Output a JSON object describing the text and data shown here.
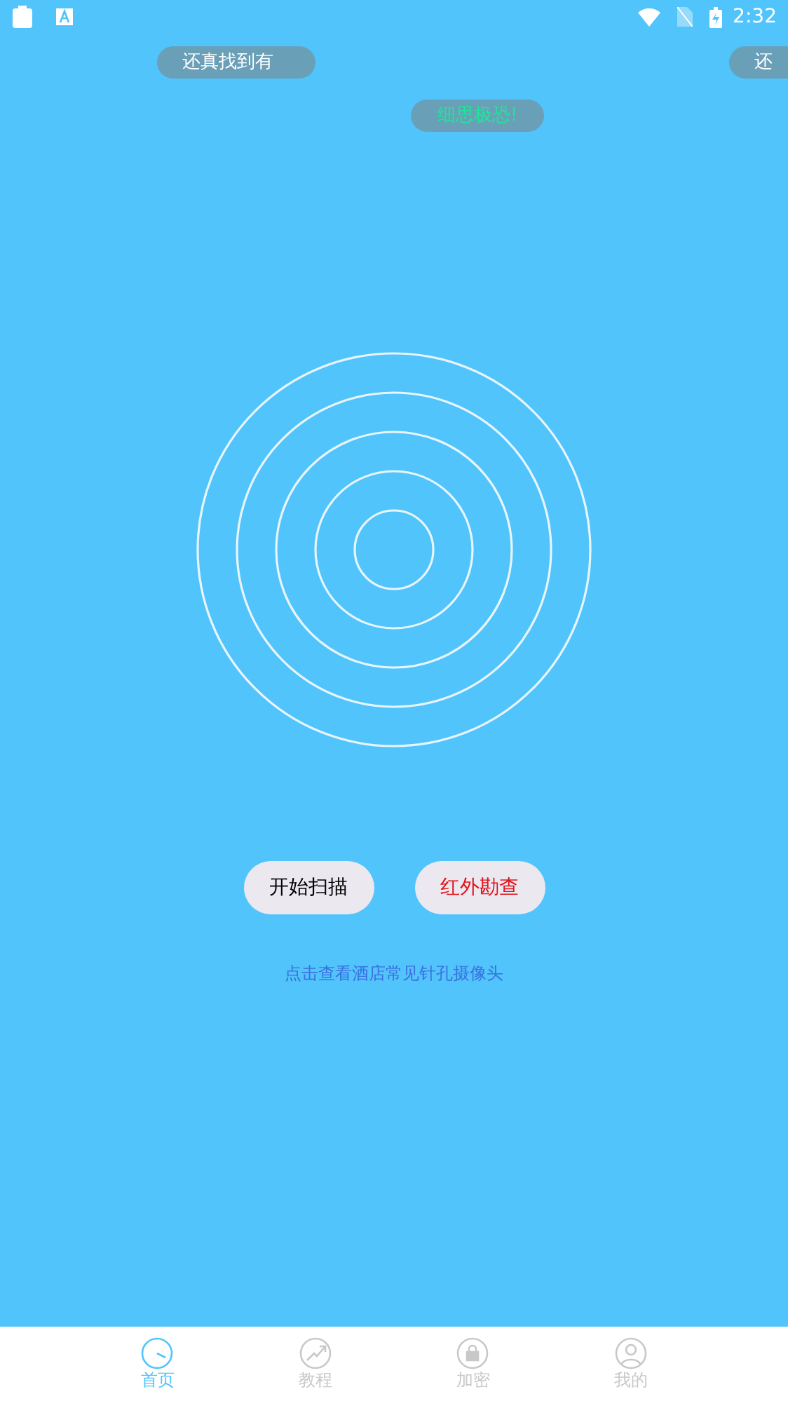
{
  "status_bar": {
    "time": "2:32"
  },
  "danmaku": [
    {
      "text": "还真找到有",
      "kind": "plain"
    },
    {
      "text": "还",
      "kind": "plain"
    },
    {
      "text": "细思极恐!",
      "kind": "highlight"
    }
  ],
  "buttons": [
    {
      "label": "开始扫描",
      "kind": "normal"
    },
    {
      "label": "红外勘查",
      "kind": "alert"
    }
  ],
  "link": "点击查看酒店常见针孔摄像头",
  "tabs": [
    {
      "label": "首页",
      "selected": true
    },
    {
      "label": "教程",
      "selected": false
    },
    {
      "label": "加密",
      "selected": false
    },
    {
      "label": "我的",
      "selected": false
    }
  ]
}
